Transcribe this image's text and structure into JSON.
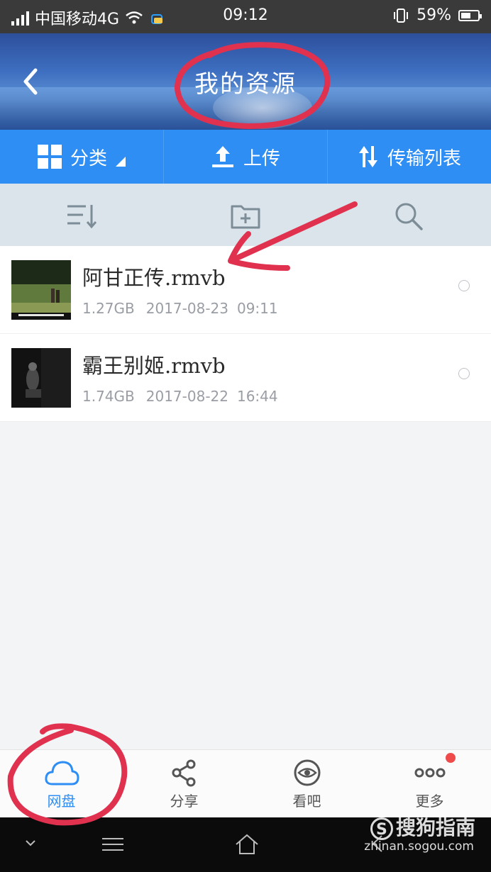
{
  "status_bar": {
    "carrier": "中国移动4G",
    "time": "09:12",
    "battery": "59%",
    "battery_level": 0.59
  },
  "header": {
    "title": "我的资源"
  },
  "toolbar": {
    "category_label": "分类",
    "upload_label": "上传",
    "transfer_label": "传输列表"
  },
  "files": [
    {
      "name": "阿甘正传.rmvb",
      "size": "1.27GB",
      "date": "2017-08-23",
      "time": "09:11"
    },
    {
      "name": "霸王别姬.rmvb",
      "size": "1.74GB",
      "date": "2017-08-22",
      "time": "16:44"
    }
  ],
  "bottom_nav": {
    "items": [
      {
        "label": "网盘",
        "icon": "cloud-icon"
      },
      {
        "label": "分享",
        "icon": "share-icon"
      },
      {
        "label": "看吧",
        "icon": "eye-icon"
      },
      {
        "label": "更多",
        "icon": "more-icon"
      }
    ]
  },
  "watermark": {
    "brand": "搜狗指南",
    "url": "zhinan.sogou.com"
  },
  "colors": {
    "accent": "#2f8ef3",
    "annotation": "#e0314f",
    "badge": "#ef4b4b"
  }
}
